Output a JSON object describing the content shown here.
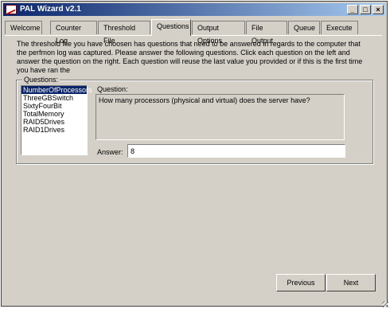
{
  "window": {
    "title": "PAL Wizard v2.1",
    "buttons": {
      "minimize": "_",
      "maximize": "□",
      "close": "×"
    }
  },
  "tabs": [
    {
      "label": "Welcome"
    },
    {
      "label": "Counter Log"
    },
    {
      "label": "Threshold File"
    },
    {
      "label": "Questions",
      "active": true
    },
    {
      "label": "Output Options"
    },
    {
      "label": "File Output"
    },
    {
      "label": "Queue"
    },
    {
      "label": "Execute"
    }
  ],
  "description": "The threshold file you have choosen has questions that need to be answered in regards to the computer that the perfmon log was captured. Please answer the following questions. Click each question on the left and answer the question on the right. Each question will reuse the last value you provided or if this is the first time you have ran the",
  "questions": {
    "group_label": "Questions:",
    "items": [
      "NumberOfProcessors",
      "ThreeGBSwitch",
      "SixtyFourBit",
      "TotalMemory",
      "RAID5Drives",
      "RAID1Drives"
    ],
    "selected_index": 0,
    "question_label": "Question:",
    "question_text": "How many processors (physical and virtual) does the server have?",
    "answer_label": "Answer:",
    "answer_value": "8"
  },
  "nav": {
    "previous": "Previous",
    "next": "Next"
  }
}
